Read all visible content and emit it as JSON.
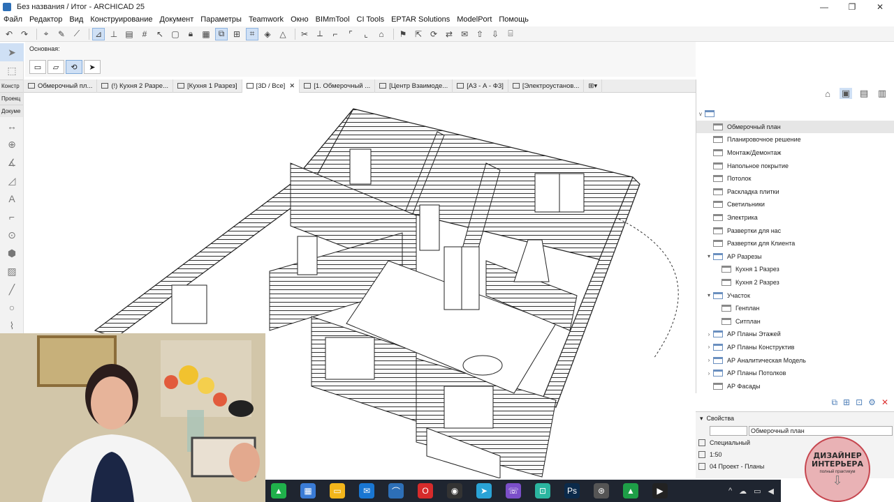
{
  "window": {
    "title": "Без названия / Итог - ARCHICAD 25",
    "buttons": [
      "—",
      "❐",
      "✕"
    ]
  },
  "menu": [
    "Файл",
    "Редактор",
    "Вид",
    "Конструирование",
    "Документ",
    "Параметры",
    "Teamwork",
    "Окно",
    "BIMmTool",
    "CI Tools",
    "EPTAR Solutions",
    "ModelPort",
    "Помощь"
  ],
  "infobox": {
    "label": "Основная:"
  },
  "toolbox": {
    "sections": [
      "Констр",
      "Проекц",
      "Докуме"
    ]
  },
  "tabs": [
    {
      "label": "Обмерочный пл...",
      "active": false
    },
    {
      "label": "(!) Кухня 2 Разре...",
      "active": false
    },
    {
      "label": "[Кухня 1 Разрез]",
      "active": false
    },
    {
      "label": "[3D / Все]",
      "active": true,
      "close": "✕"
    },
    {
      "label": "[1. Обмерочный ...",
      "active": false
    },
    {
      "label": "[Центр Взаимоде...",
      "active": false
    },
    {
      "label": "[А3 - А - Ф3]",
      "active": false
    },
    {
      "label": "[Электроустанов...",
      "active": false
    }
  ],
  "navigator": {
    "items": [
      {
        "label": "Обмерочный план",
        "indent": 1,
        "arrow": "",
        "selected": true
      },
      {
        "label": "Планировочное решение",
        "indent": 1,
        "arrow": ""
      },
      {
        "label": "Монтаж/Демонтаж",
        "indent": 1,
        "arrow": ""
      },
      {
        "label": "Напольное покрытие",
        "indent": 1,
        "arrow": ""
      },
      {
        "label": "Потолок",
        "indent": 1,
        "arrow": ""
      },
      {
        "label": "Раскладка плитки",
        "indent": 1,
        "arrow": ""
      },
      {
        "label": "Светильники",
        "indent": 1,
        "arrow": ""
      },
      {
        "label": "Электрика",
        "indent": 1,
        "arrow": ""
      },
      {
        "label": "Развертки для нас",
        "indent": 1,
        "arrow": ""
      },
      {
        "label": "Развертки для Клиента",
        "indent": 1,
        "arrow": ""
      },
      {
        "label": "АР Разрезы",
        "indent": 1,
        "arrow": "v"
      },
      {
        "label": "Кухня 1 Разрез",
        "indent": 2,
        "arrow": ""
      },
      {
        "label": "Кухня 2 Разрез",
        "indent": 2,
        "arrow": ""
      },
      {
        "label": "Участок",
        "indent": 1,
        "arrow": "v"
      },
      {
        "label": "Генплан",
        "indent": 2,
        "arrow": ""
      },
      {
        "label": "Ситплан",
        "indent": 2,
        "arrow": ""
      },
      {
        "label": "АР Планы Этажей",
        "indent": 1,
        "arrow": ">"
      },
      {
        "label": "АР Планы Конструктив",
        "indent": 1,
        "arrow": ">"
      },
      {
        "label": "АР Аналитическая Модель",
        "indent": 1,
        "arrow": ">"
      },
      {
        "label": "АР Планы Потолков",
        "indent": 1,
        "arrow": ">"
      },
      {
        "label": "АР Фасады",
        "indent": 1,
        "arrow": ""
      }
    ]
  },
  "properties": {
    "header": "Свойства",
    "name_value": "Обмерочный план",
    "special": "Специальный",
    "scale": "1:50",
    "set": "04 Проект - Планы"
  },
  "badge": {
    "line1": "ДИЗАЙНЕР",
    "line2": "ИНТЕРЬЕРА",
    "line3": "полный практикум"
  }
}
